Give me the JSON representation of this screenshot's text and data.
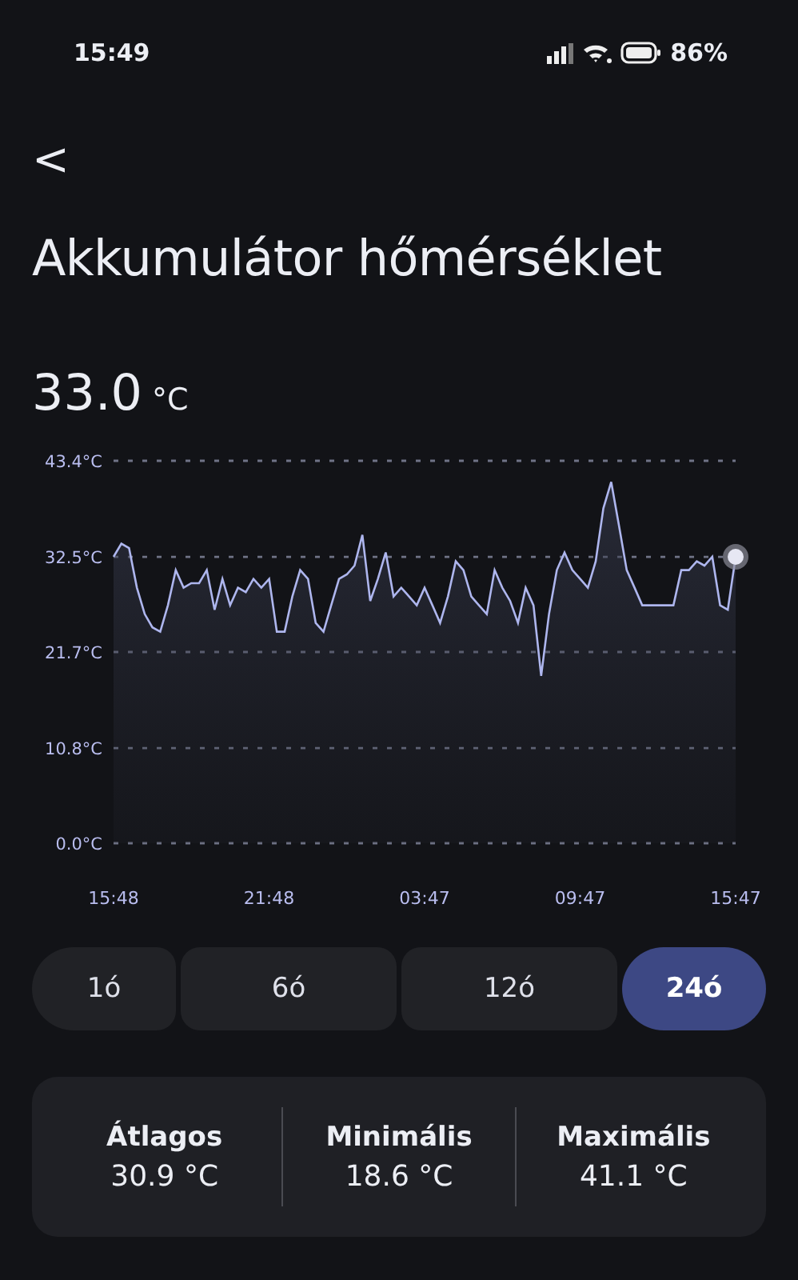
{
  "status_bar": {
    "time": "15:49",
    "battery": "86%"
  },
  "back": {
    "icon": "<"
  },
  "title": "Akkumulátor hőmérséklet",
  "current": {
    "value": "33.0",
    "unit": "°C"
  },
  "chart": {
    "chart_data": {
      "type": "area",
      "grid": true,
      "categories": [
        "15:48",
        null,
        null,
        null,
        null,
        null,
        null,
        null,
        null,
        null,
        null,
        null,
        null,
        null,
        null,
        null,
        null,
        null,
        null,
        null,
        "21:48",
        null,
        null,
        null,
        null,
        null,
        null,
        null,
        null,
        null,
        null,
        null,
        null,
        null,
        null,
        null,
        null,
        null,
        null,
        null,
        "03:47",
        null,
        null,
        null,
        null,
        null,
        null,
        null,
        null,
        null,
        null,
        null,
        null,
        null,
        null,
        null,
        null,
        null,
        null,
        null,
        "09:47",
        null,
        null,
        null,
        null,
        null,
        null,
        null,
        null,
        null,
        null,
        null,
        null,
        null,
        null,
        null,
        null,
        null,
        null,
        null,
        "15:47"
      ],
      "series": [
        {
          "color": "#aeb6ee",
          "values": [
            32.5,
            34,
            33.5,
            29,
            26,
            24.5,
            24,
            27,
            31,
            29,
            29.5,
            29.5,
            31,
            26.5,
            30,
            27,
            29,
            28.5,
            30,
            29,
            30,
            24,
            24,
            28,
            31,
            30,
            25,
            24,
            27,
            30,
            30.5,
            31.5,
            35,
            27.5,
            30,
            33,
            28,
            29,
            28,
            27,
            29,
            27,
            25,
            28,
            32,
            31,
            28,
            27,
            26,
            31,
            29,
            27.5,
            25,
            29,
            27,
            19,
            26,
            31,
            33,
            31,
            30,
            29,
            32,
            38,
            41,
            36,
            31,
            29,
            27,
            27,
            27,
            27,
            27,
            31,
            31,
            32,
            31.5,
            32.5,
            27,
            26.5,
            32.5
          ]
        }
      ],
      "ylim": [
        0,
        43.4
      ],
      "yticks": [
        {
          "value": 0,
          "label": "0.0°C"
        },
        {
          "value": 10.8,
          "label": "10.8°C"
        },
        {
          "value": 21.7,
          "label": "21.7°C"
        },
        {
          "value": 32.5,
          "label": "32.5°C"
        },
        {
          "value": 43.4,
          "label": "43.4°C"
        }
      ]
    }
  },
  "ranges": [
    {
      "label": "1ó",
      "selected": false
    },
    {
      "label": "6ó",
      "selected": false
    },
    {
      "label": "12ó",
      "selected": false
    },
    {
      "label": "24ó",
      "selected": true
    }
  ],
  "stats": [
    {
      "label": "Átlagos",
      "value": "30.9 °C"
    },
    {
      "label": "Minimális",
      "value": "18.6 °C"
    },
    {
      "label": "Maximális",
      "value": "41.1 °C"
    }
  ]
}
